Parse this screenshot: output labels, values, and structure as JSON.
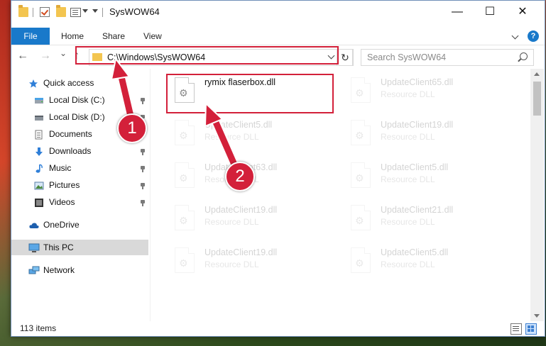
{
  "window": {
    "title": "SysWOW64"
  },
  "window_buttons": {
    "minimize": "—",
    "maximize": "☐",
    "close": "✕"
  },
  "ribbon": {
    "file": "File",
    "home": "Home",
    "share": "Share",
    "view": "View",
    "help": "?"
  },
  "navbar": {
    "back": "←",
    "forward": "→",
    "recent": "⌄",
    "up": "↑",
    "address": "C:\\Windows\\SysWOW64",
    "refresh": "↻",
    "search_placeholder": "Search SysWOW64"
  },
  "sidebar": {
    "items": [
      {
        "label": "Quick access",
        "icon": "star-icon"
      },
      {
        "label": "Local Disk (C:)",
        "icon": "drive-icon",
        "pinned": true
      },
      {
        "label": "Local Disk (D:)",
        "icon": "drive-icon",
        "pinned": true
      },
      {
        "label": "Documents",
        "icon": "documents-icon",
        "pinned": true
      },
      {
        "label": "Downloads",
        "icon": "download-icon",
        "pinned": true
      },
      {
        "label": "Music",
        "icon": "music-icon",
        "pinned": true
      },
      {
        "label": "Pictures",
        "icon": "pictures-icon",
        "pinned": true
      },
      {
        "label": "Videos",
        "icon": "videos-icon",
        "pinned": true
      },
      {
        "label": "OneDrive",
        "icon": "cloud-icon"
      },
      {
        "label": "This PC",
        "icon": "computer-icon",
        "selected": true
      },
      {
        "label": "Network",
        "icon": "network-icon"
      }
    ]
  },
  "files": [
    {
      "name": "rymix flaserbox.dll",
      "type": ""
    },
    {
      "name": "UpdateClient65.dll",
      "type": "Resource DLL"
    },
    {
      "name": "UpdateClient5.dll",
      "type": "Resource DLL"
    },
    {
      "name": "UpdateClient19.dll",
      "type": "Resource DLL"
    },
    {
      "name": "UpdateClient63.dll",
      "type": "Resource DLL"
    },
    {
      "name": "UpdateClient5.dll",
      "type": "Resource DLL"
    },
    {
      "name": "UpdateClient19.dll",
      "type": "Resource DLL"
    },
    {
      "name": "UpdateClient21.dll",
      "type": "Resource DLL"
    },
    {
      "name": "UpdateClient19.dll",
      "type": "Resource DLL"
    },
    {
      "name": "UpdateClient5.dll",
      "type": "Resource DLL"
    }
  ],
  "status": {
    "item_count": "113 items"
  },
  "annotations": {
    "step1": "1",
    "step2": "2"
  },
  "colors": {
    "accent": "#1979ca",
    "highlight": "#d3203a"
  }
}
